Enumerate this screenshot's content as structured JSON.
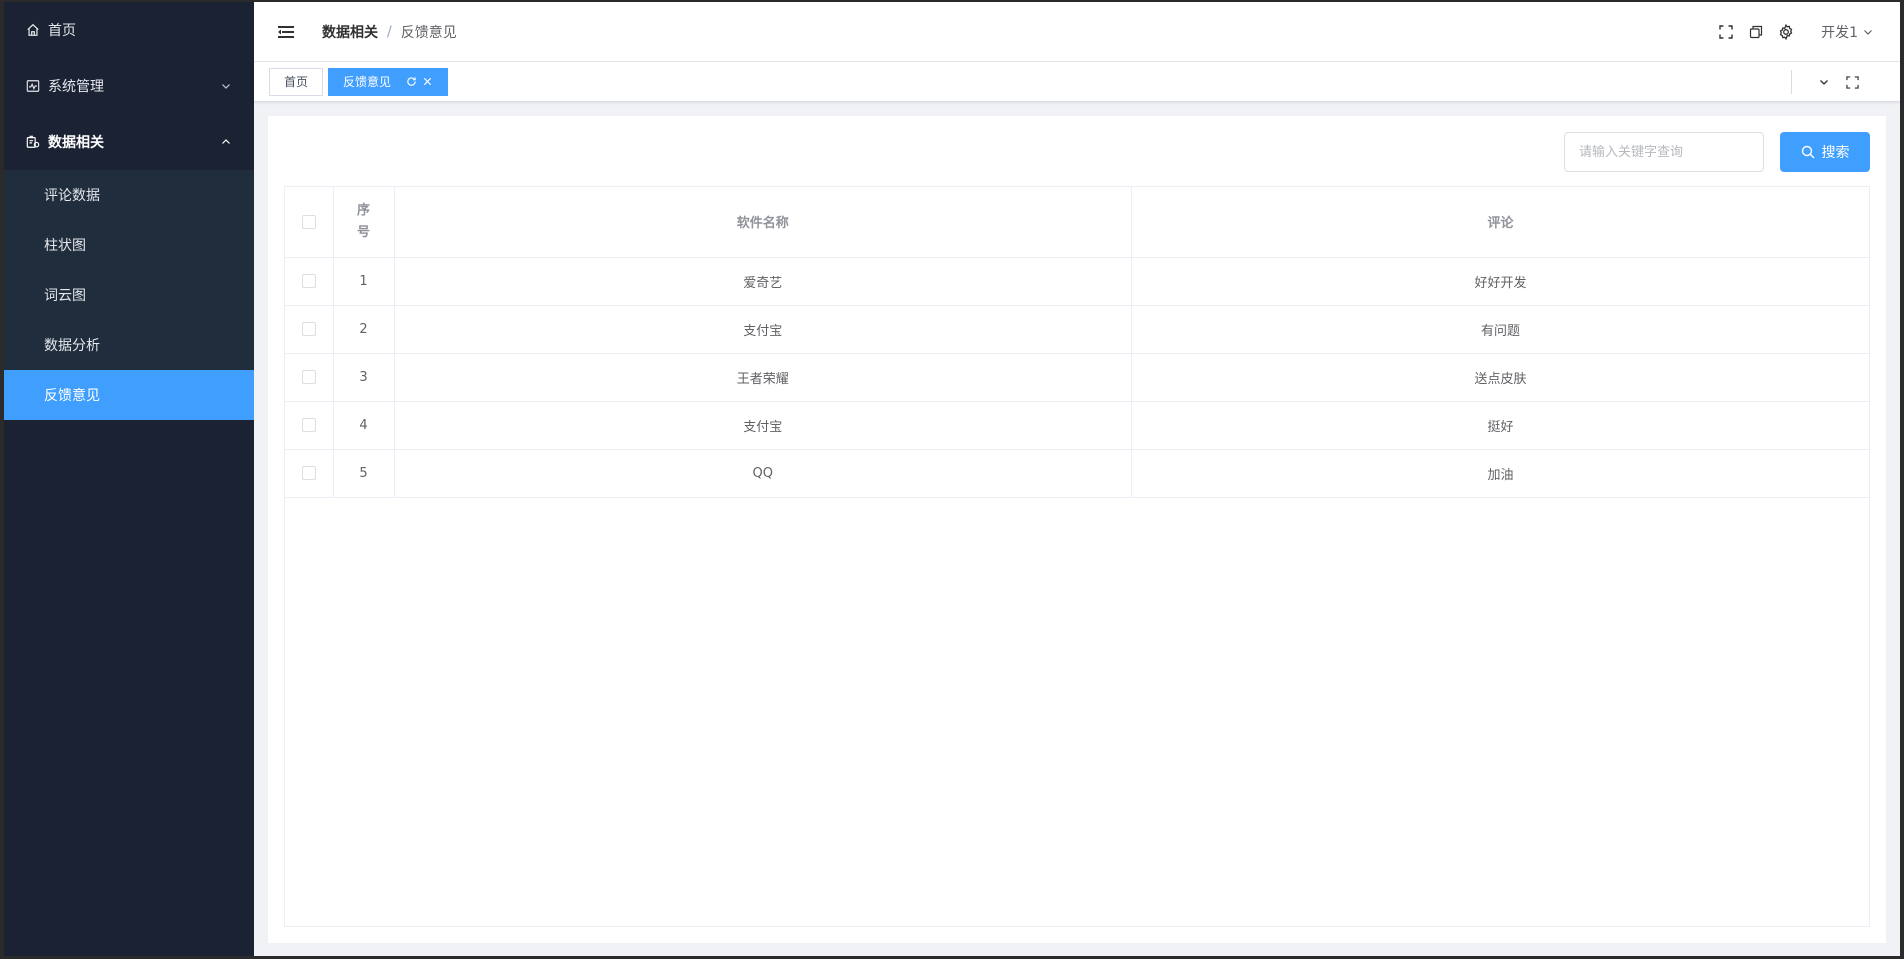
{
  "sidebar": {
    "home": "首页",
    "system": "系统管理",
    "data": "数据相关",
    "items": [
      {
        "label": "评论数据"
      },
      {
        "label": "柱状图"
      },
      {
        "label": "词云图"
      },
      {
        "label": "数据分析"
      },
      {
        "label": "反馈意见"
      }
    ]
  },
  "header": {
    "breadcrumb": [
      "数据相关",
      "反馈意见"
    ],
    "breadcrumb_sep": "/",
    "user": "开发1"
  },
  "tags": [
    {
      "label": "首页"
    },
    {
      "label": "反馈意见"
    }
  ],
  "search": {
    "placeholder": "请输入关键字查询",
    "button": "搜索"
  },
  "table": {
    "headers": [
      "序号",
      "软件名称",
      "评论"
    ],
    "rows": [
      [
        "1",
        "爱奇艺",
        "好好开发"
      ],
      [
        "2",
        "支付宝",
        "有问题"
      ],
      [
        "3",
        "王者荣耀",
        "送点皮肤"
      ],
      [
        "4",
        "支付宝",
        "挺好"
      ],
      [
        "5",
        "QQ",
        "加油"
      ]
    ]
  },
  "colors": {
    "sidebar_bg": "#1b2233",
    "submenu_bg": "#1f2d3d",
    "accent": "#409eff"
  },
  "icons": {
    "home": "home-icon",
    "system": "monitor-icon",
    "data": "data-icon",
    "hamburger": "hamburger-icon",
    "fullscreen": "fullscreen-icon",
    "copy": "copy-icon",
    "settings": "gear-icon"
  }
}
